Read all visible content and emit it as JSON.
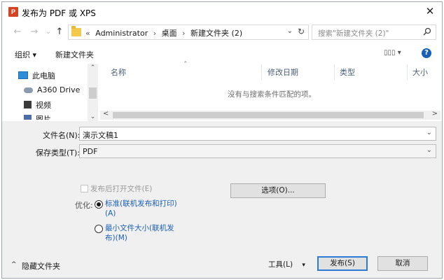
{
  "window": {
    "title": "发布为 PDF 或 XPS",
    "app_icon": "P",
    "close": "✕"
  },
  "nav": {
    "back": "←",
    "forward": "→",
    "recent": "⌄",
    "up": "↑"
  },
  "address": {
    "overflow": "«",
    "crumbs": [
      "Administrator",
      "桌面",
      "新建文件夹 (2)"
    ],
    "separator": "›",
    "dropdown": "⌄",
    "refresh": "↻"
  },
  "search": {
    "placeholder": "搜索\"新建文件夹 (2)\""
  },
  "toolbar": {
    "organize": "组织 ▾",
    "new_folder": "新建文件夹",
    "view": "▯▯▯ ▾",
    "help": "?"
  },
  "sidebar": {
    "items": [
      {
        "label": "此电脑",
        "icon": "computer-icon"
      },
      {
        "label": "A360 Drive",
        "icon": "cloud-icon"
      },
      {
        "label": "视频",
        "icon": "video-icon"
      },
      {
        "label": "图片",
        "icon": "pictures-icon"
      }
    ],
    "scroll_up": "⌃",
    "scroll_down": "⌄"
  },
  "columns": [
    "名称",
    "修改日期",
    "类型",
    "大小"
  ],
  "sort_indicator": "⌃",
  "empty_message": "没有与搜索条件匹配的项。",
  "hscroll": {
    "left": "<",
    "right": ">"
  },
  "filename": {
    "label": "文件名(N):",
    "value": "演示文稿1",
    "dropdown": "⌄"
  },
  "filetype": {
    "label": "保存类型(T):",
    "value": "PDF",
    "dropdown": "⌄"
  },
  "open_after": {
    "label": "发布后打开文件(E)",
    "checked": false,
    "enabled": false
  },
  "options_button": "选项(O)...",
  "optimize": {
    "label": "优化:",
    "standard_line1": "标准(联机发布和打印)",
    "standard_line2": "(A)",
    "minimum_line1": "最小文件大小(联机发",
    "minimum_line2": "布)(M)",
    "selected": "standard"
  },
  "hide_folders": "隐藏文件夹",
  "hide_folders_chevron": "^",
  "tools_button": "工具(L)",
  "tools_arrow": "▾",
  "publish_button": "发布(S)",
  "cancel_button": "取消",
  "colors": {
    "accent": "#2c7cd6",
    "link": "#1a5fb4",
    "panel": "#f0f0f0",
    "header_text": "#4c607a"
  }
}
